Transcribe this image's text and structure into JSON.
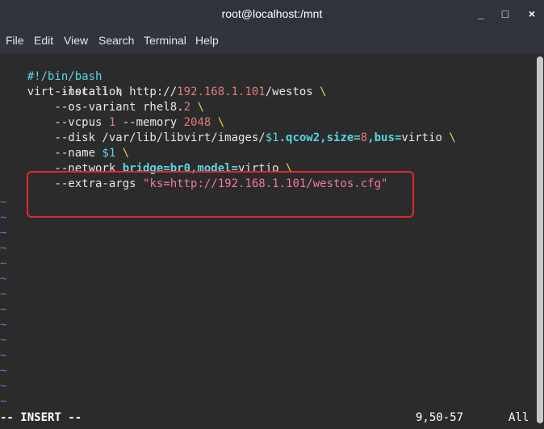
{
  "window": {
    "title": "root@localhost:/mnt",
    "minimize": "_",
    "maximize": "□",
    "close": "×"
  },
  "menu": [
    "File",
    "Edit",
    "View",
    "Search",
    "Terminal",
    "Help"
  ],
  "script": {
    "shebang": "#!/bin/bash",
    "l2": "virt-install \\",
    "l3a": "        --location http://",
    "l3b": "192.168.1.101",
    "l3c": "/westos ",
    "l3d": "\\",
    "l4a": "        --os-variant rhel8.",
    "l4b": "2",
    "l4c": " ",
    "l4d": "\\",
    "l5a": "        --vcpus ",
    "l5b": "1",
    "l5c": " --memory ",
    "l5d": "2048",
    "l5e": " ",
    "l5f": "\\",
    "l6a": "        --disk /var/lib/libvirt/images/",
    "l6b": "$1",
    "l6c": ".qcow2,size=",
    "l6d": "8",
    "l6e": ",bus=",
    "l6f": "virtio ",
    "l6g": "\\",
    "l7a": "        --name ",
    "l7b": "$1",
    "l7c": " ",
    "l7d": "\\",
    "l8a": "        --network ",
    "l8b": "bridge=br0,model=",
    "l8c": "virtio ",
    "l8d": "\\",
    "l9a": "        --extra-args ",
    "l9b": "\"ks=http://192.168.1.101/westos.cfg\""
  },
  "tilde": "~",
  "status": {
    "mode": "-- INSERT --",
    "position": "9,50-57",
    "scroll": "All"
  },
  "colors": {
    "background": "#2b2b2b",
    "highlight_box": "#e02a2a"
  }
}
